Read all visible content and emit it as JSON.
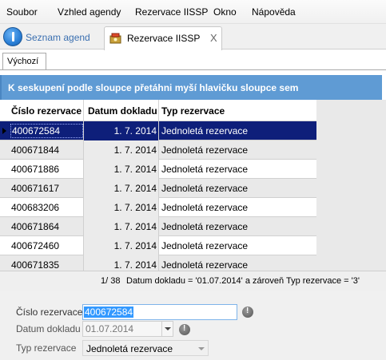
{
  "menu": [
    "Soubor",
    "Vzhled agendy",
    "Rezervace IISSP",
    "Okno",
    "Nápověda"
  ],
  "tabs": {
    "agendas": {
      "label": "Seznam agend",
      "icon": "info-icon"
    },
    "active": {
      "label": "Rezervace IISSP",
      "icon": "reservation-icon",
      "close": "X"
    }
  },
  "view_tab": "Výchozí",
  "group_panel": "K seskupení podle sloupce přetáhni myší hlavičku sloupce sem",
  "grid": {
    "columns": [
      "Číslo rezervace",
      "Datum dokladu",
      "Typ rezervace"
    ],
    "rows": [
      [
        "400672584",
        "1. 7. 2014",
        "Jednoletá rezervace"
      ],
      [
        "400671844",
        "1. 7. 2014",
        "Jednoletá rezervace"
      ],
      [
        "400671886",
        "1. 7. 2014",
        "Jednoletá rezervace"
      ],
      [
        "400671617",
        "1. 7. 2014",
        "Jednoletá rezervace"
      ],
      [
        "400683206",
        "1. 7. 2014",
        "Jednoletá rezervace"
      ],
      [
        "400671864",
        "1. 7. 2014",
        "Jednoletá rezervace"
      ],
      [
        "400672460",
        "1. 7. 2014",
        "Jednoletá rezervace"
      ],
      [
        "400671835",
        "1. 7. 2014",
        "Jednoletá rezervace"
      ]
    ]
  },
  "footer": {
    "count": "1/ 38",
    "filter": "Datum dokladu = '01.07.2014' a zároveň Typ rezervace = '3'"
  },
  "form": {
    "reservation_label": "Číslo rezervace",
    "reservation_value": "400672584",
    "date_label": "Datum dokladu",
    "date_value": "01.07.2014",
    "type_label": "Typ rezervace",
    "type_value": "Jednoletá rezervace"
  }
}
